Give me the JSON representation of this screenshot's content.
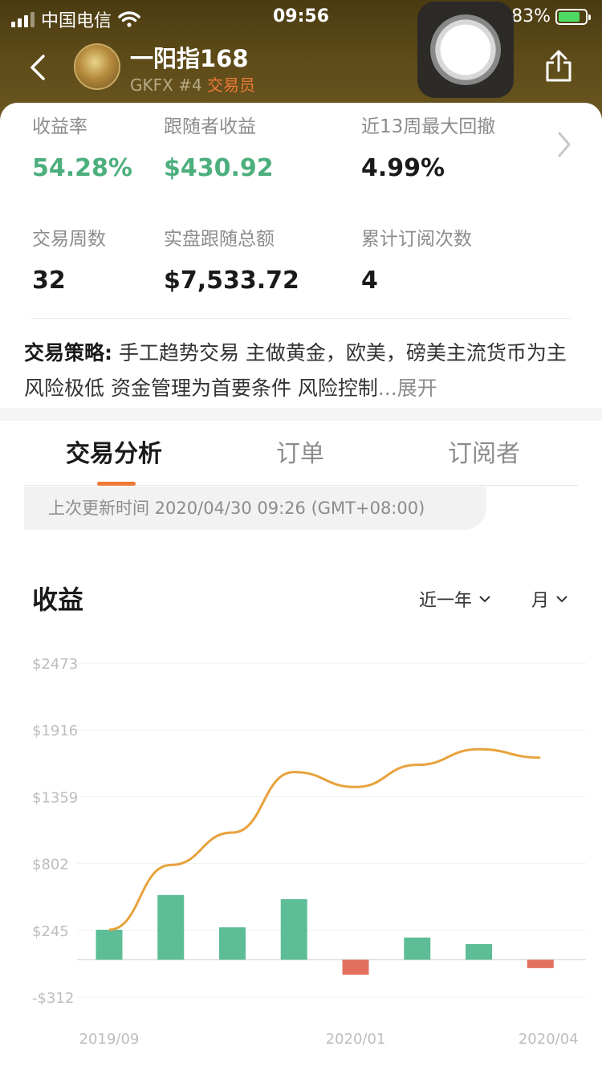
{
  "status_bar": {
    "carrier": "中国电信",
    "time": "09:56",
    "battery": "83%"
  },
  "header": {
    "trader_name": "一阳指168",
    "broker": "GKFX",
    "rank": "#4",
    "role": "交易员"
  },
  "stats": [
    {
      "label": "收益率",
      "value": "54.28%",
      "color": "#4caf7d"
    },
    {
      "label": "跟随者收益",
      "value": "$430.92",
      "color": "#4caf7d"
    },
    {
      "label": "近13周最大回撤",
      "value": "4.99%"
    },
    {
      "label": "交易周数",
      "value": "32"
    },
    {
      "label": "实盘跟随总额",
      "value": "$7,533.72"
    },
    {
      "label": "累计订阅次数",
      "value": "4"
    }
  ],
  "strategy": {
    "label": "交易策略:",
    "text": " 手工趋势交易 主做黄金，欧美，磅美主流货币为主 风险极低 资金管理为首要条件 风险控制",
    "more": "...展开"
  },
  "tabs": [
    "交易分析",
    "订单",
    "订阅者"
  ],
  "update_text": "上次更新时间 2020/04/30 09:26 (GMT+08:00)",
  "chart_section": {
    "title": "收益",
    "range_filter": "近一年",
    "period_filter": "月"
  },
  "colors": {
    "accent": "#ee7a38",
    "positive": "#5dbd96",
    "negative": "#e3705f",
    "line": "#e8a23c"
  },
  "chart_data": {
    "type": "bar",
    "y_ticks": [
      "$2473",
      "$1916",
      "$1359",
      "$802",
      "$245",
      "-$312"
    ],
    "x_ticks": [
      "2019/09",
      "2020/01",
      "2020/04"
    ],
    "ylim": [
      -312,
      2473
    ],
    "categories": [
      "2019/09",
      "2019/10",
      "2019/11",
      "2019/12",
      "2020/01",
      "2020/02",
      "2020/03",
      "2020/04"
    ],
    "series": [
      {
        "type": "bar",
        "values": [
          250,
          540,
          270,
          505,
          -125,
          185,
          130,
          -70
        ]
      },
      {
        "type": "line",
        "values": [
          250,
          790,
          1060,
          1565,
          1440,
          1625,
          1755,
          1685
        ]
      }
    ]
  }
}
